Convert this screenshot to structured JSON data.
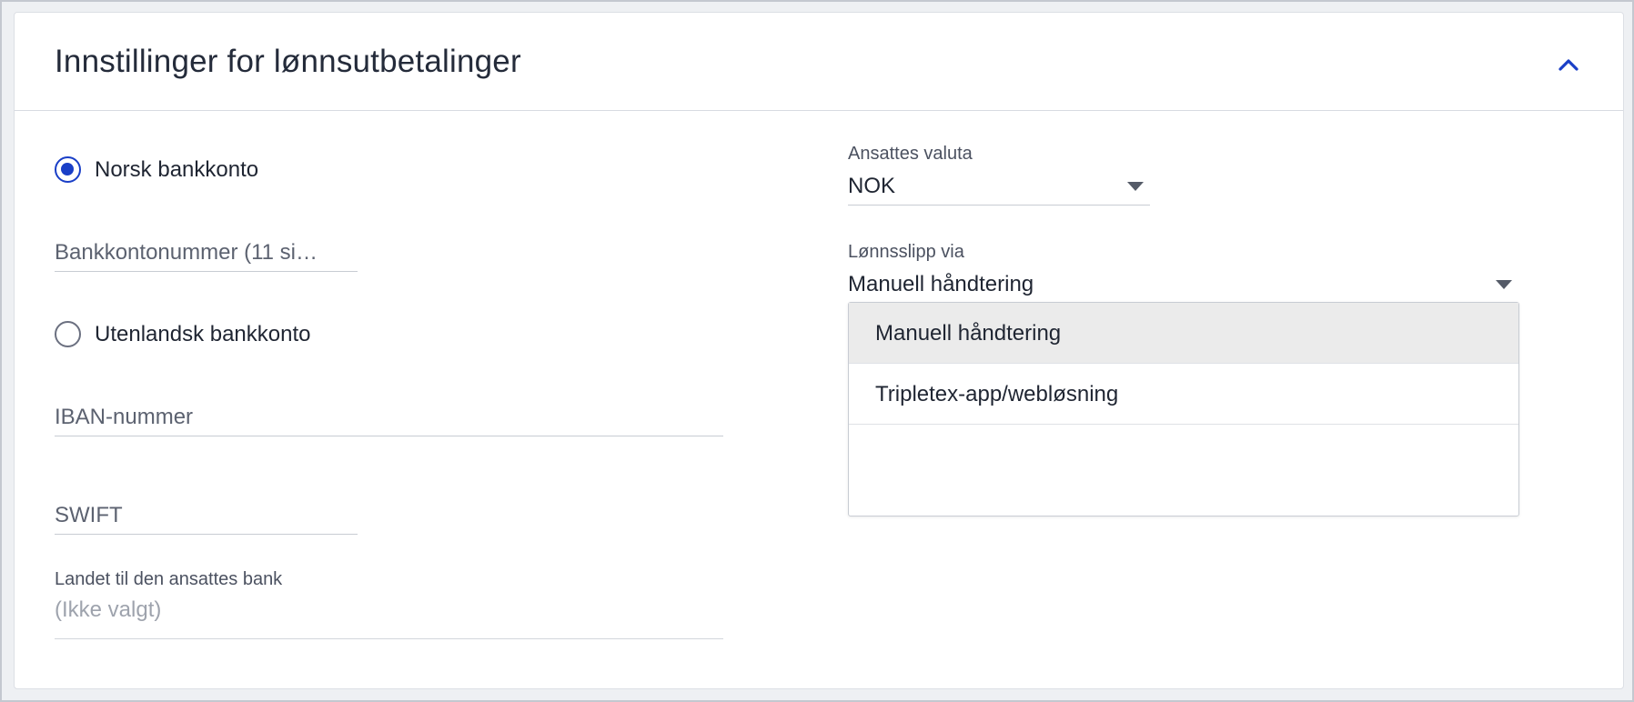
{
  "header": {
    "title": "Innstillinger for lønnsutbetalinger"
  },
  "left": {
    "norsk_radio": {
      "label": "Norsk bankkonto",
      "checked": true
    },
    "bankkonto_input": {
      "placeholder": "Bankkontonummer (11 si…",
      "value": ""
    },
    "utenlandsk_radio": {
      "label": "Utenlandsk bankkonto",
      "checked": false
    },
    "iban_input": {
      "placeholder": "IBAN-nummer",
      "value": ""
    },
    "swift_input": {
      "placeholder": "SWIFT",
      "value": ""
    },
    "country": {
      "label": "Landet til den ansattes bank",
      "value": "(Ikke valgt)"
    }
  },
  "right": {
    "currency": {
      "label": "Ansattes valuta",
      "value": "NOK"
    },
    "payslip": {
      "label": "Lønnsslipp via",
      "value": "Manuell håndtering",
      "options": [
        "Manuell håndtering",
        "Tripletex-app/webløsning"
      ]
    }
  },
  "colors": {
    "accent": "#1a3fc7",
    "highlight": "#ebebeb"
  }
}
